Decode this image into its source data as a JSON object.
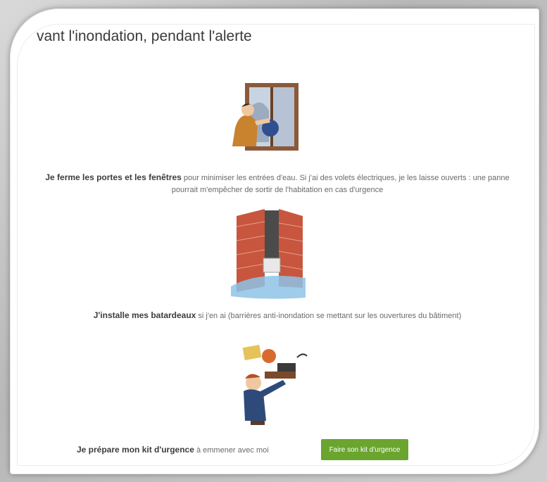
{
  "section": {
    "title": "vant l'inondation, pendant l'alerte"
  },
  "items": [
    {
      "bold": "Je ferme les portes et les fenêtres",
      "text": " pour minimiser les entrées d'eau. Si j'ai des volets électriques, je les laisse ouverts : une panne",
      "text2": "pourrait m'empêcher de sortir de l'habitation en cas d'urgence",
      "illustration": "man-closing-window"
    },
    {
      "bold": "J'installe mes batardeaux",
      "text": " si j'en ai (barrières anti-inondation se mettant sur les ouvertures du bâtiment)",
      "illustration": "flood-barrier-door"
    },
    {
      "bold": "Je prépare mon kit d'urgence",
      "text": " à emmener avec moi",
      "illustration": "man-carrying-emergency-kit"
    }
  ],
  "button": {
    "label": "Faire son kit d'urgence"
  },
  "colors": {
    "button_bg": "#6aa52f",
    "text": "#6a6a6a",
    "bold_text": "#3c3c3c"
  }
}
